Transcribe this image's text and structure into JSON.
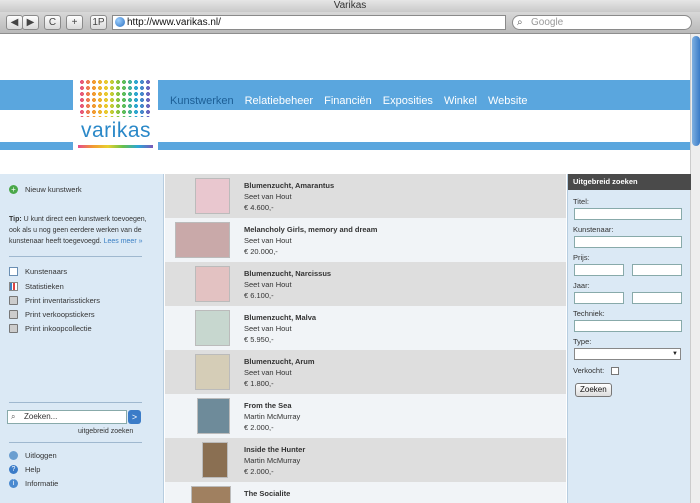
{
  "window": {
    "title": "Varikas"
  },
  "browser": {
    "url": "http://www.varikas.nl/",
    "search_placeholder": "Google",
    "back_label": "◀",
    "forward_label": "▶",
    "reload_label": "C",
    "add_label": "+",
    "tab_label": "1P"
  },
  "site": {
    "logo_text": "varikas",
    "nav": [
      {
        "label": "Kunstwerken"
      },
      {
        "label": "Relatiebeheer"
      },
      {
        "label": "Financiën"
      },
      {
        "label": "Exposities"
      },
      {
        "label": "Winkel"
      },
      {
        "label": "Website"
      }
    ]
  },
  "sidebar": {
    "new_item": "Nieuw kunstwerk",
    "tip_bold": "Tip:",
    "tip_text": " U kunt direct een kunstwerk toevoegen, ook als u nog geen eerdere werken van de kunstenaar heeft toegevoegd. ",
    "tip_more": "Lees meer »",
    "links": [
      {
        "label": "Kunstenaars",
        "icon": "document-icon"
      },
      {
        "label": "Statistieken",
        "icon": "chart-icon"
      },
      {
        "label": "Print inventarisstickers",
        "icon": "printer-icon"
      },
      {
        "label": "Print verkoopstickers",
        "icon": "printer-icon"
      },
      {
        "label": "Print inkoopcollectie",
        "icon": "printer-icon"
      }
    ],
    "search_placeholder": "Zoeken...",
    "search_go": ">",
    "advanced_link": "uitgebreid zoeken",
    "footer_links": [
      {
        "label": "Uitloggen",
        "icon": "user-icon"
      },
      {
        "label": "Help",
        "icon": "help-icon"
      },
      {
        "label": "Informatie",
        "icon": "info-icon"
      }
    ]
  },
  "artworks": [
    {
      "title": "Blumenzucht, Amarantus",
      "artist": "Seet van Hout",
      "price": "€ 4.600,-",
      "thumb_color": "#e9c7cf"
    },
    {
      "title": "Melancholy Girls, memory and dream",
      "artist": "Seet van Hout",
      "price": "€ 20.000,-",
      "thumb_color": "#c9a9a9"
    },
    {
      "title": "Blumenzucht, Narcissus",
      "artist": "Seet van Hout",
      "price": "€ 6.100,-",
      "thumb_color": "#e3c2c2"
    },
    {
      "title": "Blumenzucht, Malva",
      "artist": "Seet van Hout",
      "price": "€ 5.950,-",
      "thumb_color": "#c7d7cf"
    },
    {
      "title": "Blumenzucht, Arum",
      "artist": "Seet van Hout",
      "price": "€ 1.800,-",
      "thumb_color": "#d5cdb7"
    },
    {
      "title": "From the Sea",
      "artist": "Martin McMurray",
      "price": "€ 2.000,-",
      "thumb_color": "#6e8b9a"
    },
    {
      "title": "Inside the Hunter",
      "artist": "Martin McMurray",
      "price": "€ 2.000,-",
      "thumb_color": "#8a6f52"
    },
    {
      "title": "The Socialite",
      "artist": "",
      "price": "",
      "thumb_color": "#a08060"
    }
  ],
  "advanced_search": {
    "title": "Uitgebreid zoeken",
    "fields": {
      "titel": "Titel:",
      "kunstenaar": "Kunstenaar:",
      "prijs": "Prijs:",
      "jaar": "Jaar:",
      "techniek": "Techniek:",
      "type": "Type:",
      "verkocht": "Verkocht:"
    },
    "submit": "Zoeken"
  }
}
